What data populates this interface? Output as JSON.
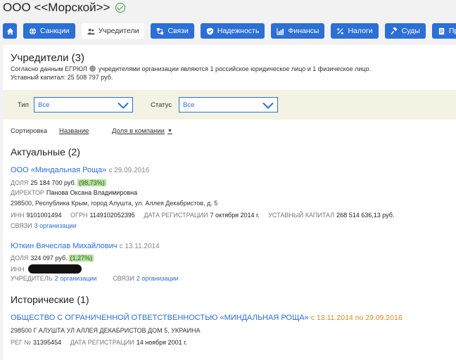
{
  "header": {
    "company_name": "ООО <<Морской>>"
  },
  "tabs": [
    {
      "label": "",
      "icon": "home-icon"
    },
    {
      "label": "Санкции",
      "icon": "globe-icon"
    },
    {
      "label": "Учредители",
      "icon": "people-icon"
    },
    {
      "label": "Связи",
      "icon": "link-icon"
    },
    {
      "label": "Надежность",
      "icon": "shield-icon"
    },
    {
      "label": "Финансы",
      "icon": "chart-icon"
    },
    {
      "label": "Налоги",
      "icon": "percent-icon"
    },
    {
      "label": "Суды",
      "icon": "gavel-icon"
    },
    {
      "label": "Про",
      "icon": "document-icon"
    }
  ],
  "founders": {
    "title": "Учредители (3)",
    "description_pre": "Согласно данным ЕГРЮЛ",
    "description_post": "учредителями организации являются 1 российское юридическое лицо и 1 физическое лицо.",
    "capital": "Уставный капитал: 25 508 797 руб."
  },
  "filters": {
    "type_label": "Тип",
    "type_value": "Все",
    "status_label": "Статус",
    "status_value": "Все"
  },
  "sort": {
    "label": "Сортировка",
    "by_name": "Название",
    "by_share": "Доля в компании"
  },
  "current": {
    "title": "Актуальные (2)",
    "org": {
      "name": "ООО «Миндальная Роща»",
      "since": "с 29.09.2016",
      "share_label": "ДОЛЯ",
      "share_value": "25 184 700 руб.",
      "share_pct": "(98,73%)",
      "director_label": "ДИРЕКТОР",
      "director_value": "Панова Оксана Владимировна",
      "address": "298500, Республика Крым, город Алушта, ул. Аллея Декабристов, д. 5",
      "inn_label": "ИНН",
      "inn_value": "9101001494",
      "ogrn_label": "ОГРН",
      "ogrn_value": "1149102052395",
      "reg_label": "ДАТА РЕГИСТРАЦИИ",
      "reg_value": "7 октября 2014 г.",
      "cap_label": "УСТАВНЫЙ КАПИТАЛ",
      "cap_value": "268 514 636,13 руб.",
      "links_label": "СВЯЗИ",
      "links_value": "3 организации"
    },
    "person": {
      "name": "Юткин Вячеслав Михайлович",
      "since": "с 13.11.2014",
      "share_label": "ДОЛЯ",
      "share_value": "324 097 руб.",
      "share_pct": "(1,27%)",
      "inn_label": "ИНН",
      "founder_label": "УЧРЕДИТЕЛЬ",
      "founder_value": "2 организации",
      "links_label": "СВЯЗИ",
      "links_value": "2 организации"
    }
  },
  "historical": {
    "title": "Исторические (1)",
    "org": {
      "name": "ОБЩЕСТВО С ОГРАНИЧЕННОЙ ОТВЕТСТВЕННОСТЬЮ «МИНДАЛЬНАЯ РОЩА»",
      "period": "с 13.11.2014 по 29.09.2016",
      "address": "298500 Г АЛУШТА УЛ АЛЛЕЯ ДЕКАБРИСТОВ ДОМ 5, УКРАИНА",
      "reg_no_label": "РЕГ №",
      "reg_no_value": "31395454",
      "reg_label": "ДАТА РЕГИСТРАЦИИ",
      "reg_value": "14 ноября 2001 г."
    }
  },
  "colors": {
    "accent": "#2c6fd6",
    "verified": "#3aa34a",
    "share_badge": "#b7e0a0",
    "filter_bg": "#f4f3e3",
    "period": "#d98a1e"
  }
}
